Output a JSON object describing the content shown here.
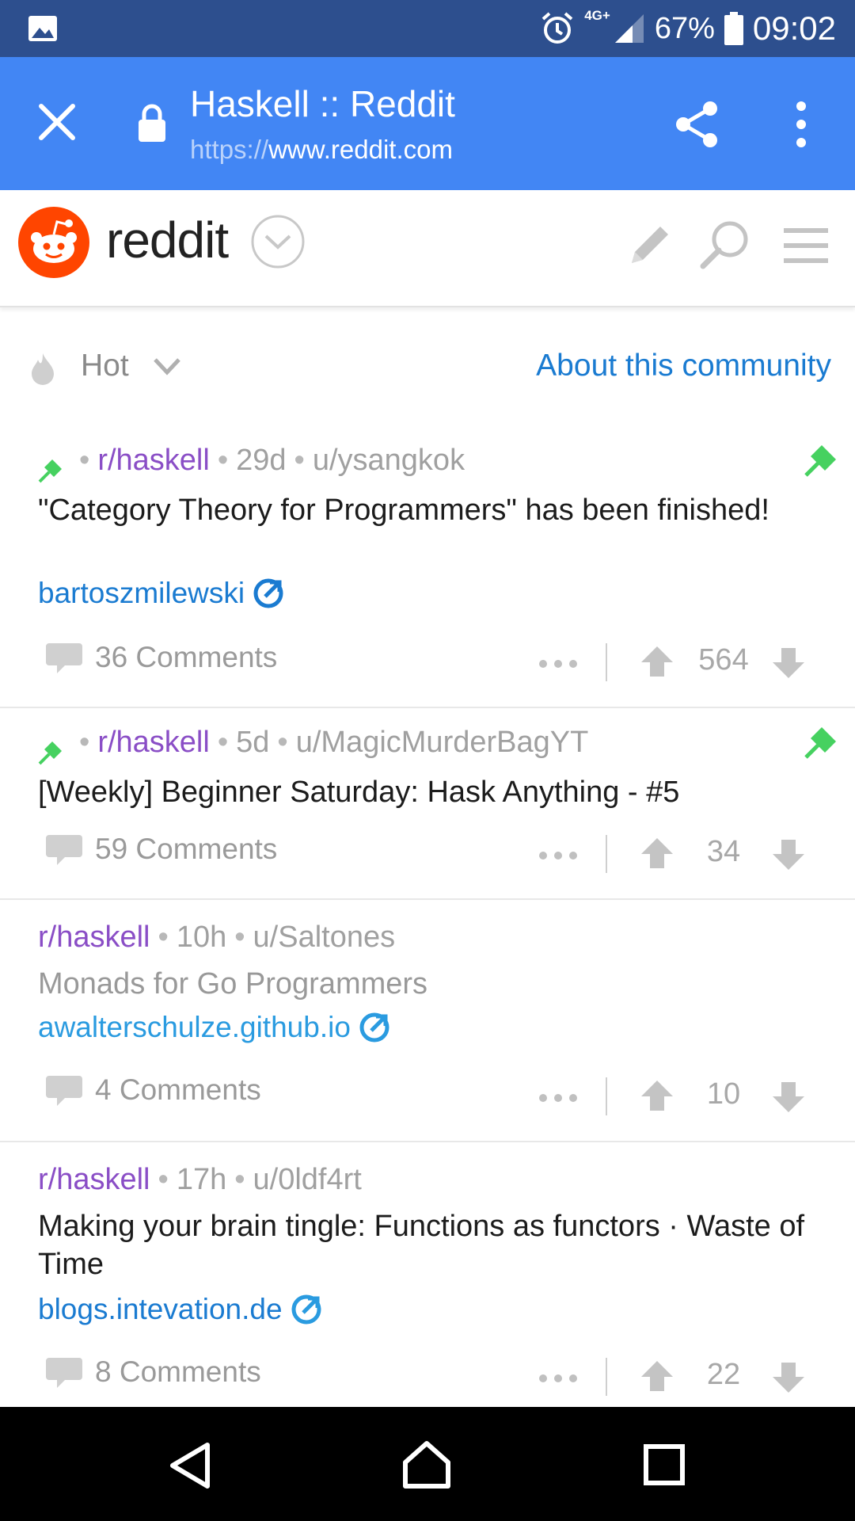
{
  "status_bar": {
    "network": "4G+",
    "battery": "67%",
    "time": "09:02"
  },
  "browser": {
    "title": "Haskell :: Reddit",
    "url_scheme": "https://",
    "url_host": "www.reddit.com"
  },
  "reddit_header": {
    "wordmark": "reddit"
  },
  "sort": {
    "label": "Hot",
    "about_link": "About this community"
  },
  "posts": [
    {
      "pinned": true,
      "subreddit": "r/haskell",
      "age": "29d",
      "author": "u/ysangkok",
      "title": "\"Category Theory for Programmers\" has been finished!",
      "link": "bartoszmilewski",
      "comments": "36 Comments",
      "score": "564"
    },
    {
      "pinned": true,
      "subreddit": "r/haskell",
      "age": "5d",
      "author": "u/MagicMurderBagYT",
      "title": "[Weekly] Beginner Saturday: Hask Anything - #5",
      "comments": "59 Comments",
      "score": "34"
    },
    {
      "pinned": false,
      "visited": true,
      "subreddit": "r/haskell",
      "age": "10h",
      "author": "u/Saltones",
      "title": "Monads for Go Programmers",
      "link": "awalterschulze.github.io",
      "comments": "4 Comments",
      "score": "10"
    },
    {
      "pinned": false,
      "subreddit": "r/haskell",
      "age": "17h",
      "author": "u/0ldf4rt",
      "title": "Making your brain tingle: Functions as functors · Waste of Time",
      "link": "blogs.intevation.de",
      "comments": "8 Comments",
      "score": "22"
    }
  ],
  "colors": {
    "status_bar": "#2d4f8e",
    "toolbar": "#4286f4",
    "reddit_orange": "#ff4500",
    "subreddit": "#8a4ec6",
    "link": "#1a7bd1",
    "pin": "#46d160"
  }
}
